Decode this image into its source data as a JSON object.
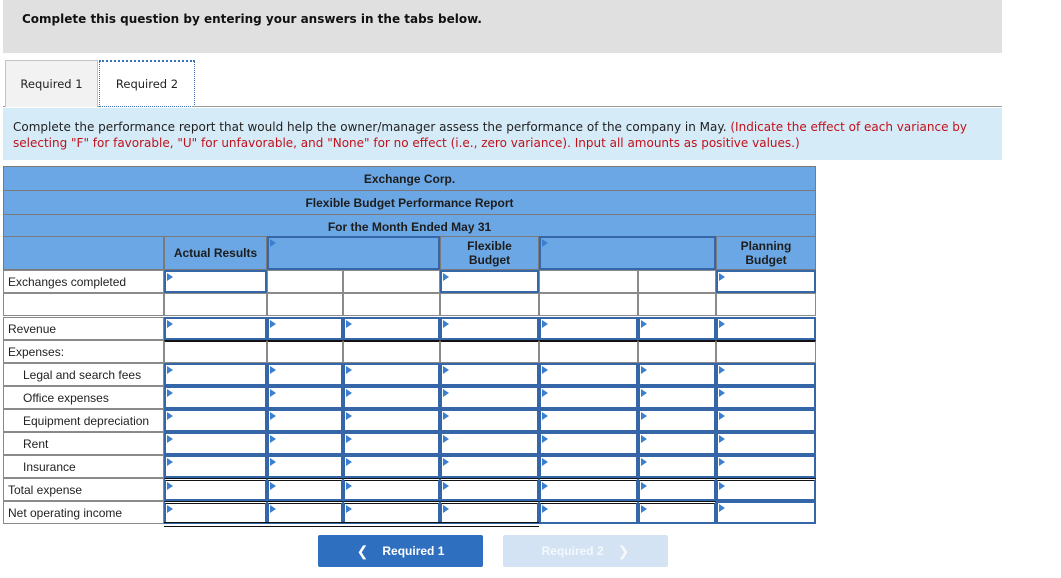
{
  "banner": {
    "text": "Complete this question by entering your answers in the tabs below."
  },
  "tabs": [
    {
      "label": "Required 1",
      "active": false
    },
    {
      "label": "Required 2",
      "active": true
    }
  ],
  "instructions": {
    "main": "Complete the performance report that would help the owner/manager assess the performance of the company in May.",
    "note": "(Indicate the effect of each variance by selecting \"F\" for favorable, \"U\" for unfavorable, and \"None\" for no effect (i.e., zero variance). Input all amounts as positive values.)"
  },
  "report": {
    "company": "Exchange Corp.",
    "title": "Flexible Budget Performance Report",
    "period": "For the Month Ended May 31",
    "columns": {
      "actual": "Actual Results",
      "variance1": "",
      "flexible_line1": "Flexible",
      "flexible_line2": "Budget",
      "variance2": "",
      "planning_line1": "Planning",
      "planning_line2": "Budget"
    },
    "rows": [
      {
        "label": "Exchanges completed"
      },
      {
        "label": ""
      },
      {
        "label": "Revenue"
      },
      {
        "label": "Expenses:"
      },
      {
        "label": "Legal and search fees"
      },
      {
        "label": "Office expenses"
      },
      {
        "label": "Equipment depreciation"
      },
      {
        "label": "Rent"
      },
      {
        "label": "Insurance"
      },
      {
        "label": "Total expense"
      },
      {
        "label": "Net operating income"
      }
    ]
  },
  "nav": {
    "prev_label": "Required 1",
    "next_label": "Required 2",
    "prev_icon": "chevron-left-icon",
    "next_icon": "chevron-right-icon"
  }
}
